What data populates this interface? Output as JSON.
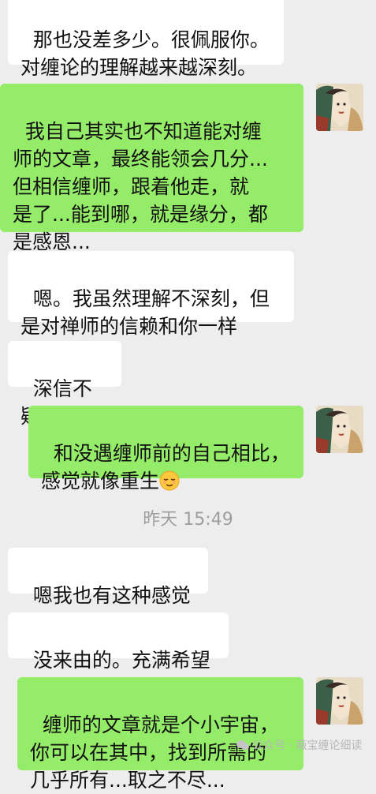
{
  "messages": [
    {
      "side": "in",
      "text": "那也没差多少。很佩服你。\n对缠论的理解越来越深刻。"
    },
    {
      "side": "out",
      "text": "我自己其实也不知道能对缠\n师的文章，最终能领会几分...\n但相信缠师，跟着他走，就\n是了...能到哪，就是缘分，都\n是感恩..."
    },
    {
      "side": "in",
      "text": "嗯。我虽然理解不深刻，但\n是对禅师的信赖和你一样"
    },
    {
      "side": "in",
      "text": "深信不疑"
    },
    {
      "side": "out",
      "text": "和没遇缠师前的自己相比，\n感觉就像重生"
    },
    {
      "side": "in",
      "text": "嗯我也有这种感觉"
    },
    {
      "side": "in",
      "text": "没来由的。充满希望"
    },
    {
      "side": "out",
      "text": "缠师的文章就是个小宇宙，\n你可以在其中，找到所需的\n几乎所有...取之不尽..."
    }
  ],
  "timestamp": "昨天 15:49",
  "watermark": "公众号 · 薇宝缠论细读",
  "emoji_icon": "relieved-face-icon",
  "colors": {
    "background": "#EDEDED",
    "incoming": "#FFFFFF",
    "outgoing": "#95EC69",
    "timestamp": "#9E9E9E"
  }
}
